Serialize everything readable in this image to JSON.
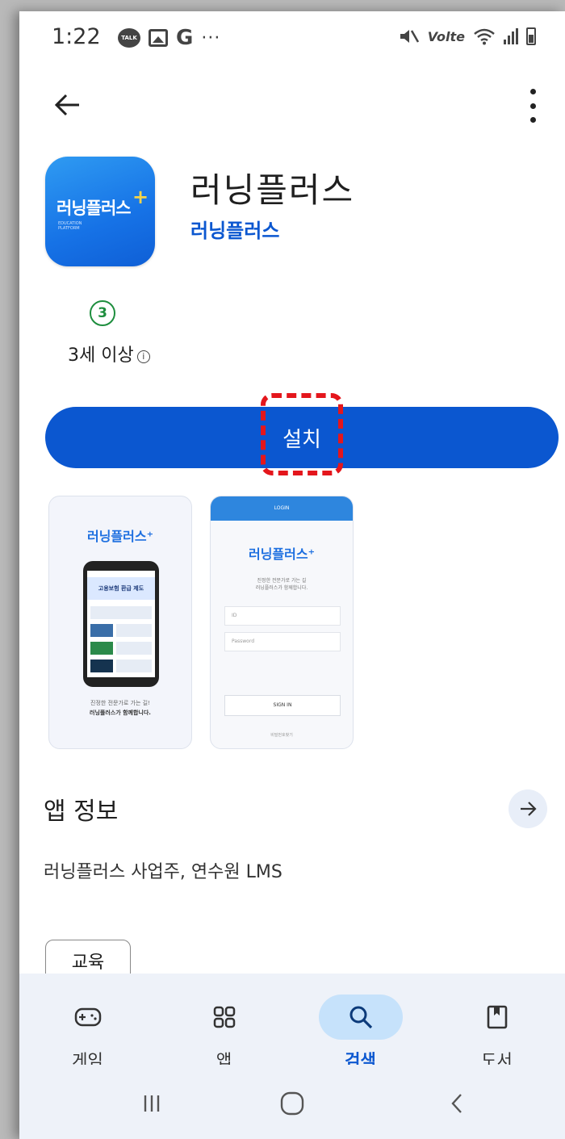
{
  "status_bar": {
    "time": "1:22",
    "talk_badge": "TALK",
    "notif_g": "G",
    "notif_more": "···",
    "volte": "Volte"
  },
  "app": {
    "title": "러닝플러스",
    "developer": "러닝플러스",
    "icon_text": "러닝플러스",
    "icon_sub": "EDUCATION\nPLATFORM"
  },
  "rating": {
    "badge": "3",
    "label": "3세 이상"
  },
  "install": {
    "label": "설치"
  },
  "screenshots": {
    "shot1": {
      "logo": "러닝플러스⁺",
      "banner": "고용보험 환급 제도",
      "caption_line1": "진정한 전문가로 가는 길!",
      "caption_line2": "러닝플러스가 함께합니다."
    },
    "shot2": {
      "header": "LOGIN",
      "logo": "러닝플러스⁺",
      "sub_line1": "진정한 전문가로 가는 길",
      "sub_line2": "러닝플러스가 함께합니다.",
      "id_placeholder": "ID",
      "password_placeholder": "Password",
      "signin": "SIGN IN",
      "footer": "비밀번호찾기"
    }
  },
  "about": {
    "title": "앱 정보",
    "description": "러닝플러스 사업주, 연수원 LMS",
    "tag": "교육"
  },
  "bottom_nav": {
    "items": [
      {
        "label": "게임",
        "icon": "gamepad-icon"
      },
      {
        "label": "앱",
        "icon": "apps-grid-icon"
      },
      {
        "label": "검색",
        "icon": "search-icon",
        "active": true
      },
      {
        "label": "도서",
        "icon": "book-icon"
      }
    ]
  },
  "colors": {
    "accent": "#0b57d0",
    "rating_green": "#1e8e3e",
    "highlight_red": "#e4161c",
    "nav_bg": "#eef2f9",
    "nav_active_pill": "#c6e2fb"
  }
}
